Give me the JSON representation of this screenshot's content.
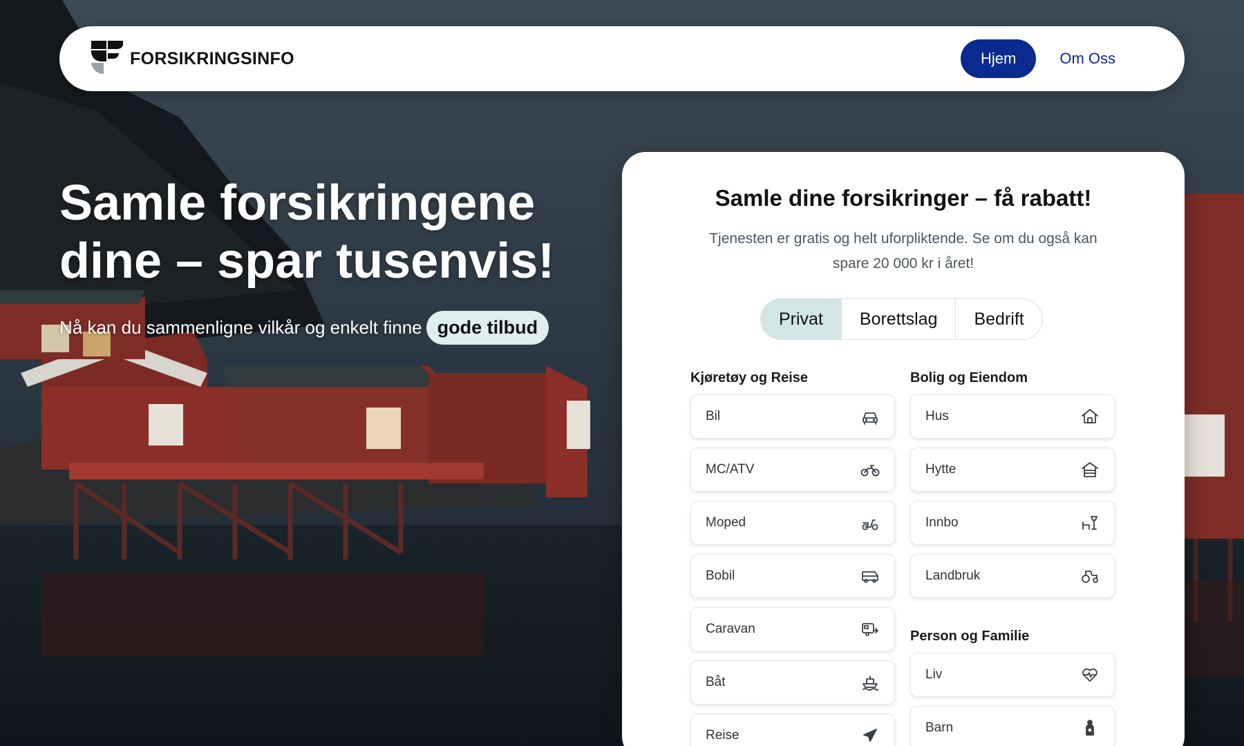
{
  "brand": {
    "name": "FORSIKRINGSINFO",
    "icon": "forsikringsinfo-logo"
  },
  "nav": {
    "home_label": "Hjem",
    "about_label": "Om Oss",
    "accent": "#0b2a8f"
  },
  "hero": {
    "title": "Samle forsikringene dine – spar tusenvis!",
    "subtitle": "Nå kan du sammenligne vilkår og enkelt finne",
    "highlight": "gode tilbud"
  },
  "card": {
    "title": "Samle dine forsikringer – få rabatt!",
    "description": "Tjenesten er gratis og helt uforpliktende. Se om du også kan spare 20 000 kr i året!",
    "tabs": [
      {
        "label": "Privat",
        "active": true
      },
      {
        "label": "Borettslag",
        "active": false
      },
      {
        "label": "Bedrift",
        "active": false
      }
    ],
    "active_tab_color": "#d2e6e6",
    "sections": {
      "vehicles": {
        "heading": "Kjøretøy og Reise",
        "items": [
          {
            "label": "Bil",
            "icon": "car-icon"
          },
          {
            "label": "MC/ATV",
            "icon": "motorcycle-icon"
          },
          {
            "label": "Moped",
            "icon": "moped-icon"
          },
          {
            "label": "Bobil",
            "icon": "motorhome-icon"
          },
          {
            "label": "Caravan",
            "icon": "caravan-icon"
          },
          {
            "label": "Båt",
            "icon": "boat-icon"
          },
          {
            "label": "Reise",
            "icon": "plane-icon"
          }
        ]
      },
      "property": {
        "heading": "Bolig og Eiendom",
        "items": [
          {
            "label": "Hus",
            "icon": "house-icon"
          },
          {
            "label": "Hytte",
            "icon": "cabin-icon"
          },
          {
            "label": "Innbo",
            "icon": "furniture-icon"
          },
          {
            "label": "Landbruk",
            "icon": "tractor-icon"
          }
        ]
      },
      "person": {
        "heading": "Person og Familie",
        "items": [
          {
            "label": "Liv",
            "icon": "heart-pulse-icon"
          },
          {
            "label": "Barn",
            "icon": "child-icon"
          }
        ]
      }
    }
  }
}
